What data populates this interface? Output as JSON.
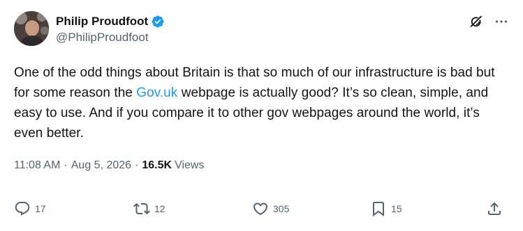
{
  "author": {
    "display_name": "Philip Proudfoot",
    "handle": "@PhilipProudfoot",
    "verified": true,
    "avatar_icon": "profile-photo"
  },
  "top_actions": {
    "grok_icon": "grok-icon",
    "more_icon": "more-icon"
  },
  "post": {
    "text_before_link": "One of the odd things about Britain is that so much of our infrastructure is bad but for some reason the ",
    "link_text": "Gov.uk",
    "text_after_link": " webpage is actually good?  It’s so clean, simple, and easy to use. And if you compare it to other gov webpages around the world, it’s even better."
  },
  "meta": {
    "time": "11:08 AM",
    "separator": "·",
    "date": "Aug 5, 2026",
    "views_count": "16.5K",
    "views_label": "Views"
  },
  "actions": {
    "reply_count": "17",
    "repost_count": "12",
    "like_count": "305",
    "bookmark_count": "15"
  },
  "colors": {
    "text": "#0f1419",
    "secondary": "#536471",
    "link": "#1d9bf0",
    "verified": "#1d9bf0"
  }
}
